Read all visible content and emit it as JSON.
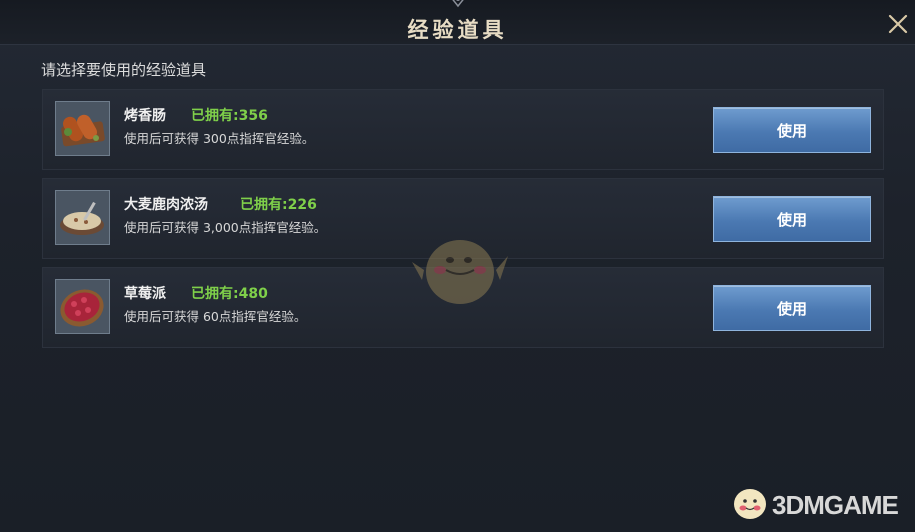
{
  "dialog": {
    "title": "经验道具",
    "subtitle": "请选择要使用的经验道具"
  },
  "items": [
    {
      "name": "烤香肠",
      "owned": "已拥有:356",
      "desc": "使用后可获得 300点指挥官经验。",
      "button": "使用",
      "icon": "sausage-icon"
    },
    {
      "name": "大麦鹿肉浓汤",
      "owned": "已拥有:226",
      "desc": "使用后可获得 3,000点指挥官经验。",
      "button": "使用",
      "icon": "soup-icon"
    },
    {
      "name": "草莓派",
      "owned": "已拥有:480",
      "desc": "使用后可获得 60点指挥官经验。",
      "button": "使用",
      "icon": "strawberry-pie-icon"
    }
  ],
  "watermark": {
    "text": "3DMGAME"
  },
  "colors": {
    "owned": "#7fd04a",
    "button": "#4b79b2",
    "title": "#e7dcc4"
  }
}
